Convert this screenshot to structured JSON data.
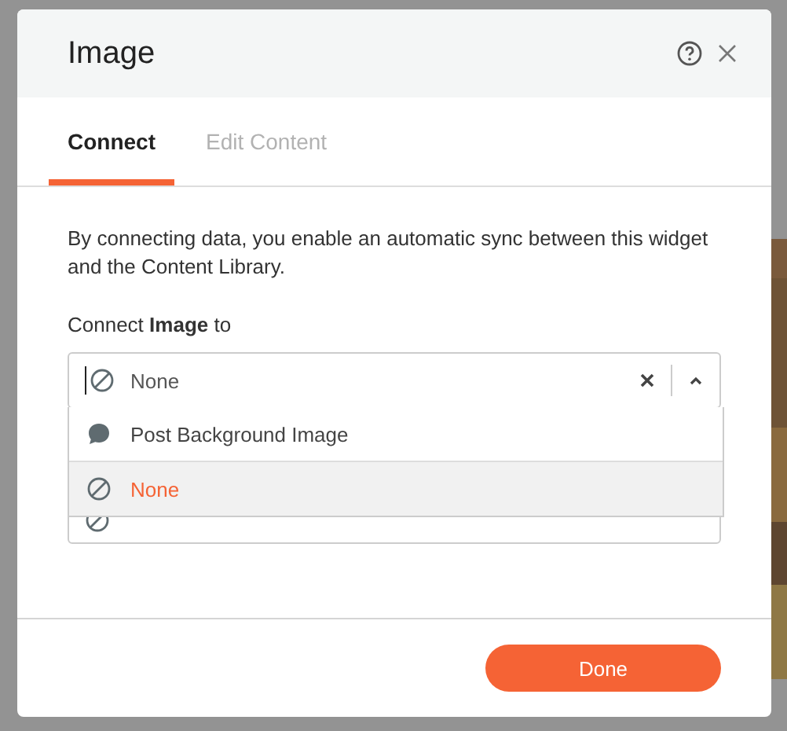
{
  "dialog": {
    "title": "Image"
  },
  "tabs": [
    {
      "label": "Connect",
      "selected": true
    },
    {
      "label": "Edit Content",
      "selected": false
    }
  ],
  "description": "By connecting data, you enable an automatic sync between this widget and the Content Library.",
  "connect_label": "Connect **Image** to",
  "field": {
    "value": "None",
    "open": true
  },
  "options": [
    {
      "label": "Post Background Image",
      "kind": "field",
      "selected": false
    },
    {
      "label": "None",
      "kind": "none",
      "selected": true
    }
  ],
  "buttons": [
    "Done"
  ]
}
